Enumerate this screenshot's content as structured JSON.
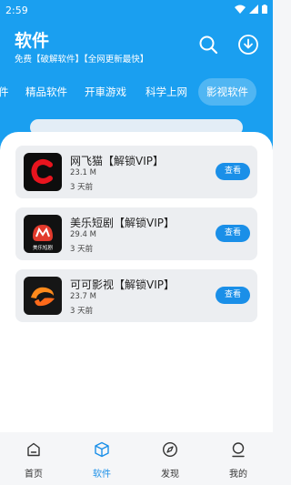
{
  "status_bar": {
    "time": "2:59"
  },
  "header": {
    "title": "软件",
    "subtitle": "免费【破解软件】【全网更新最快】",
    "search_icon": "search-icon",
    "download_icon": "download-icon"
  },
  "tabs": [
    {
      "label": "件",
      "active": false
    },
    {
      "label": "精品软件",
      "active": false
    },
    {
      "label": "开車游戏",
      "active": false
    },
    {
      "label": "科学上网",
      "active": false
    },
    {
      "label": "影视软件",
      "active": true
    }
  ],
  "apps": [
    {
      "name": "网飞猫【解锁VIP】",
      "size": "23.1 M",
      "date": "3 天前",
      "button": "查看",
      "icon": "netflix-cat-logo"
    },
    {
      "name": "美乐短剧【解锁VIP】",
      "size": "29.4 M",
      "date": "3 天前",
      "button": "查看",
      "icon": "meile-drama-logo",
      "icon_text": "美乐短剧"
    },
    {
      "name": "可可影视【解锁VIP】",
      "size": "23.7 M",
      "date": "3 天前",
      "button": "查看",
      "icon": "keke-video-logo"
    }
  ],
  "bottom_nav": [
    {
      "label": "首页",
      "icon": "home-icon",
      "active": false
    },
    {
      "label": "软件",
      "icon": "package-icon",
      "active": true
    },
    {
      "label": "发现",
      "icon": "compass-icon",
      "active": false
    },
    {
      "label": "我的",
      "icon": "user-icon",
      "active": false
    }
  ],
  "colors": {
    "primary": "#1a9ff0",
    "button": "#1a8fe8",
    "background": "#f5f6f8"
  }
}
